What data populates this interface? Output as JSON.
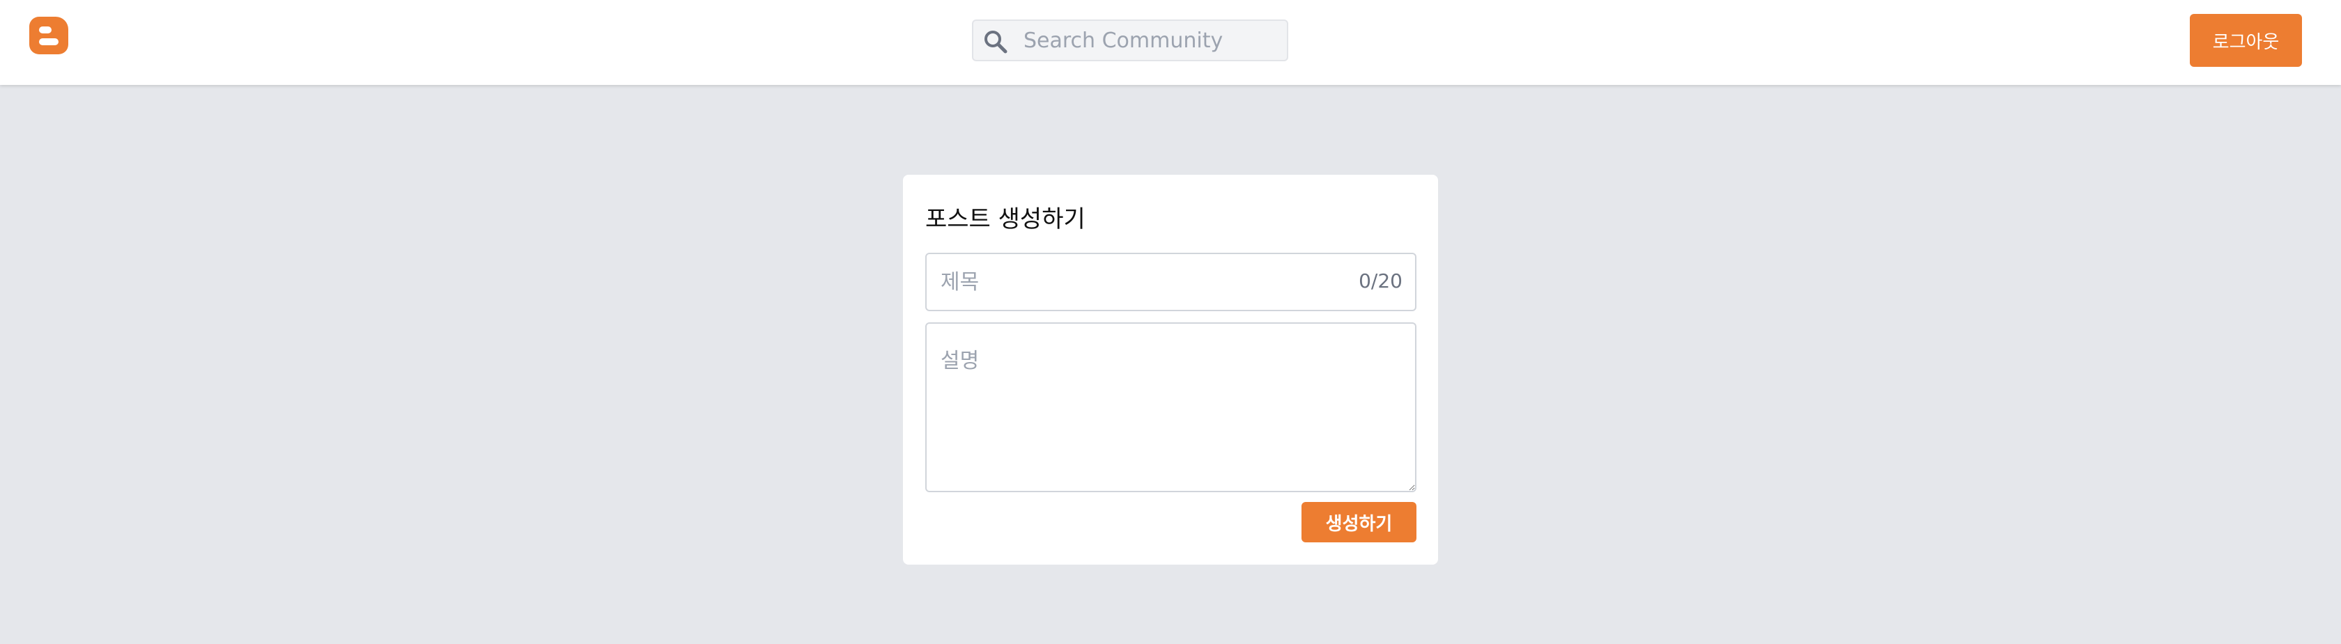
{
  "header": {
    "logo_icon": "blogger-logo-icon",
    "search": {
      "icon": "search-icon",
      "placeholder": "Search Community",
      "value": ""
    },
    "logout_label": "로그아웃"
  },
  "post_form": {
    "title": "포스트 생성하기",
    "title_field": {
      "placeholder": "제목",
      "value": "",
      "counter": "0/20"
    },
    "description_field": {
      "placeholder": "설명",
      "value": ""
    },
    "submit_label": "생성하기"
  },
  "colors": {
    "accent": "#ed7d31",
    "page_background": "#e5e7eb",
    "surface": "#ffffff"
  }
}
